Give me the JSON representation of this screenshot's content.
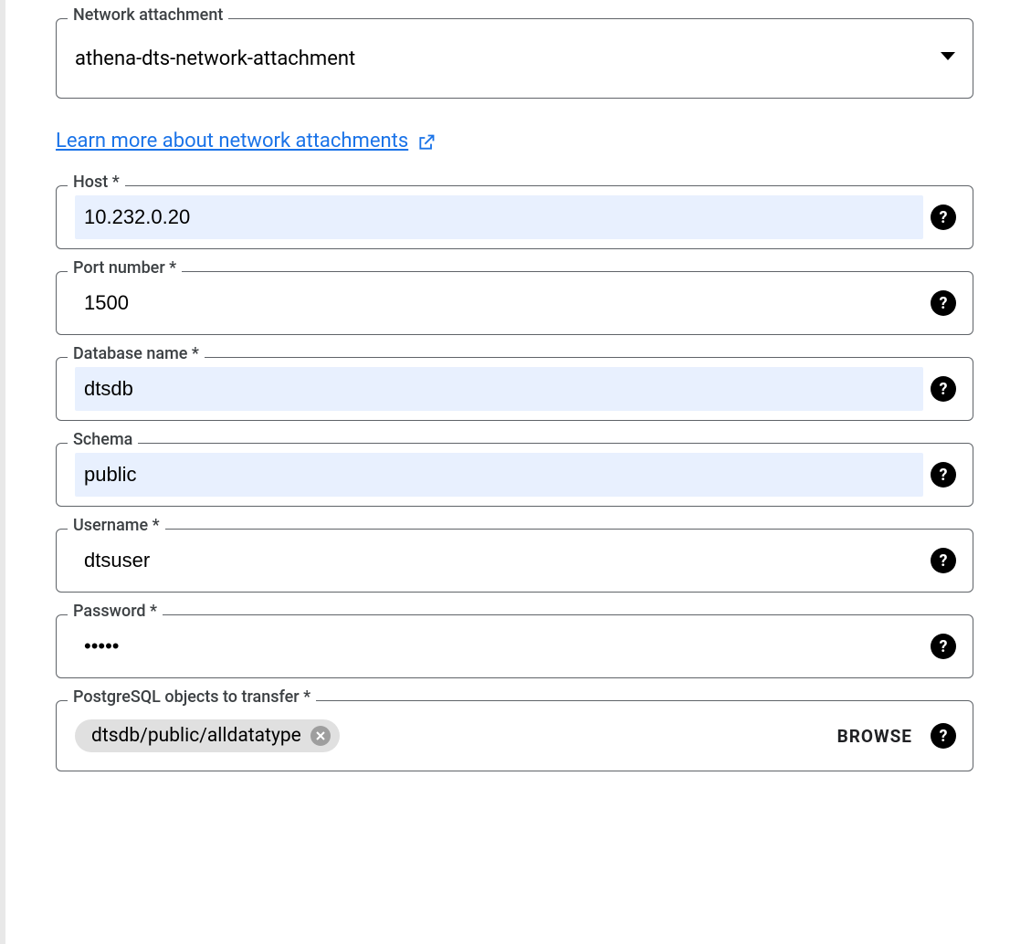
{
  "network_attachment": {
    "label": "Network attachment",
    "value": "athena-dts-network-attachment"
  },
  "learn_more": {
    "text": "Learn more about network attachments"
  },
  "host": {
    "label": "Host *",
    "value": "10.232.0.20"
  },
  "port": {
    "label": "Port number *",
    "value": "1500"
  },
  "database": {
    "label": "Database name *",
    "value": "dtsdb"
  },
  "schema": {
    "label": "Schema",
    "value": "public"
  },
  "username": {
    "label": "Username *",
    "value": "dtsuser"
  },
  "password": {
    "label": "Password *",
    "value": "•••••"
  },
  "objects": {
    "label": "PostgreSQL objects to transfer *",
    "chip": "dtsdb/public/alldatatype",
    "browse": "BROWSE"
  },
  "help_glyph": "?"
}
